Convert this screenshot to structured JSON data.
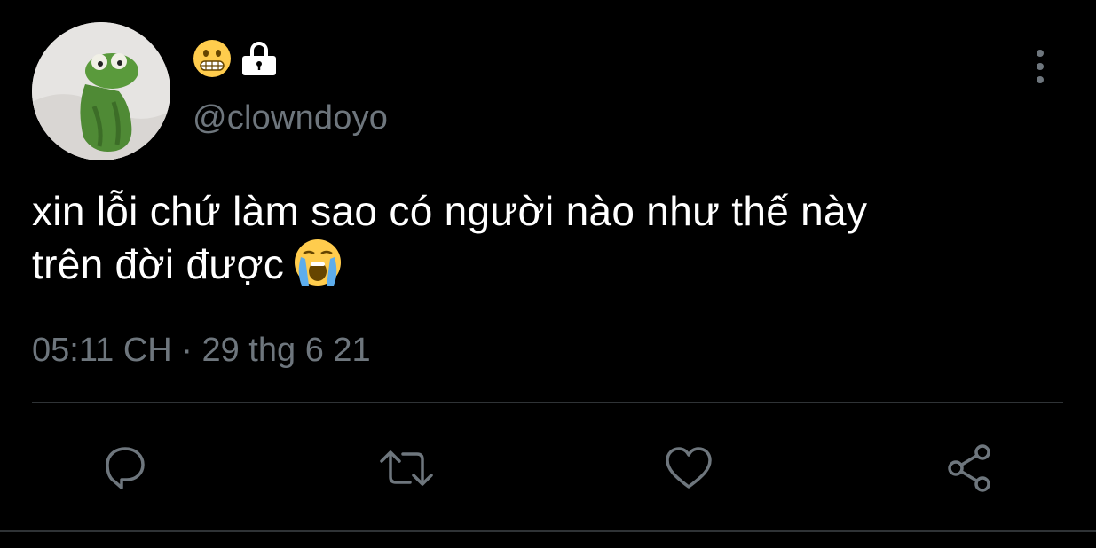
{
  "author": {
    "display_name_icons": [
      "grimacing-face-emoji",
      "lock-icon"
    ],
    "handle": "@clowndoyo"
  },
  "tweet": {
    "text_line1": "xin lỗi chứ làm sao có người nào như thế này",
    "text_line2": "trên đời được",
    "trailing_emoji": "loudly-crying-face-emoji",
    "timestamp": "05:11 CH · 29 thg 6 21"
  },
  "actions": {
    "reply_icon": "reply-icon",
    "retweet_icon": "retweet-icon",
    "like_icon": "heart-icon",
    "share_icon": "share-icon"
  },
  "colors": {
    "background": "#000000",
    "text": "#ffffff",
    "muted": "#6e767d",
    "divider": "#2f3336"
  }
}
